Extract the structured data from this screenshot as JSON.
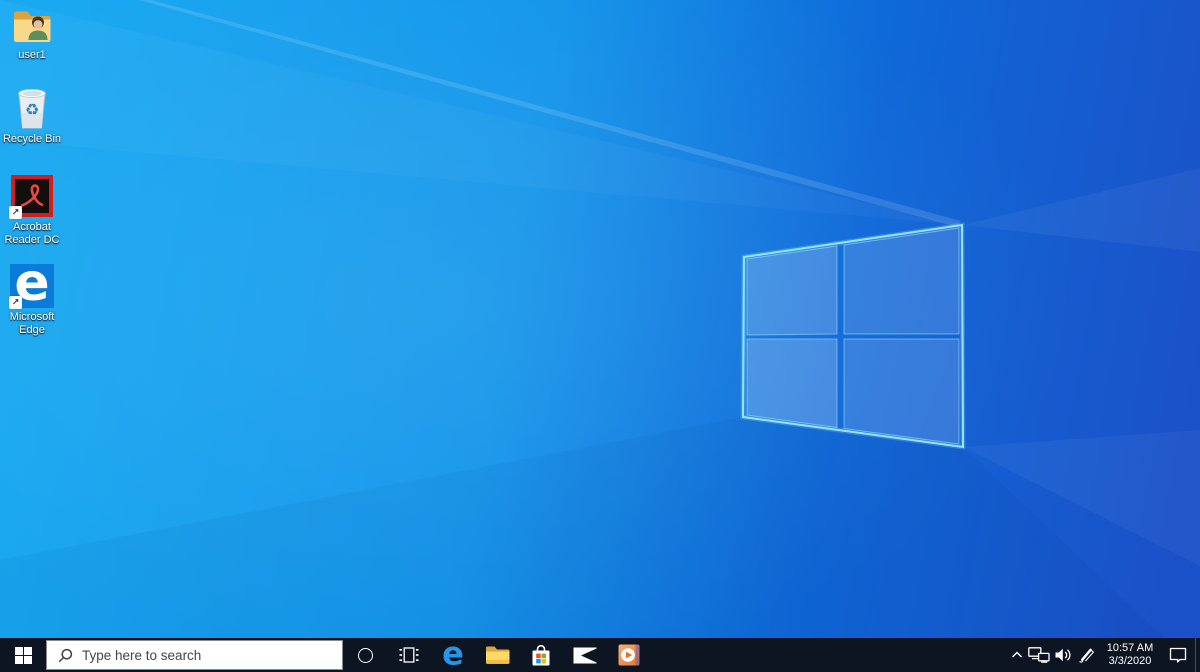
{
  "desktop": {
    "icons": [
      {
        "id": "user1",
        "label": "user1"
      },
      {
        "id": "recycle-bin",
        "label": "Recycle Bin"
      },
      {
        "id": "acrobat-reader-dc",
        "label": "Acrobat Reader DC"
      },
      {
        "id": "microsoft-edge",
        "label": "Microsoft Edge"
      }
    ]
  },
  "taskbar": {
    "search": {
      "placeholder": "Type here to search"
    },
    "pinned_buttons": [
      "start",
      "cortana",
      "task-view",
      "microsoft-edge",
      "file-explorer",
      "microsoft-store",
      "mail",
      "movies-and-tv"
    ],
    "tray": {
      "time": "10:57 AM",
      "date": "3/3/2020",
      "icons": [
        "hidden-icons-chevron",
        "network",
        "volume",
        "windows-ink-workspace",
        "action-center",
        "show-desktop"
      ]
    }
  },
  "colors": {
    "taskbar_bg": "#0d1522",
    "wallpaper_left": "#1aa9f1",
    "wallpaper_right": "#1b51c8",
    "logo_edge_glow": "#9ff1ff",
    "edge_blue": "#2596e8",
    "folder_yellow": "#f9d78b",
    "acrobat_red": "#cf1f1f",
    "store_tile_colors": [
      "#f25022",
      "#7fba00",
      "#00a4ef",
      "#ffb900"
    ]
  }
}
